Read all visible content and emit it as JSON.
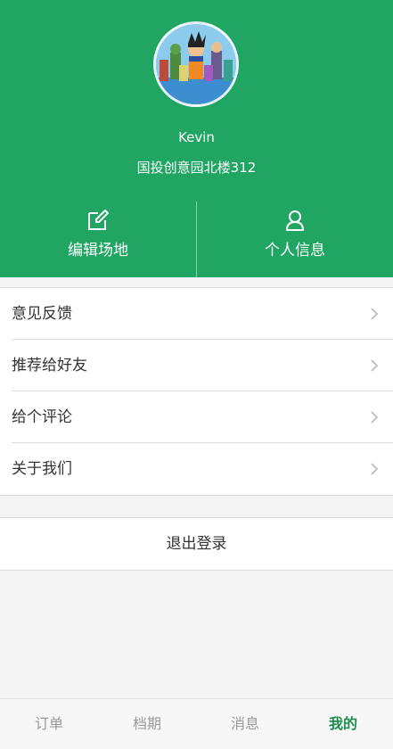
{
  "profile": {
    "name": "Kevin",
    "address": "国投创意园北楼312"
  },
  "header_buttons": [
    {
      "label": "编辑场地",
      "icon": "edit-icon"
    },
    {
      "label": "个人信息",
      "icon": "person-icon"
    }
  ],
  "menu": {
    "items": [
      {
        "label": "意见反馈"
      },
      {
        "label": "推荐给好友"
      },
      {
        "label": "给个评论"
      },
      {
        "label": "关于我们"
      }
    ]
  },
  "logout_label": "退出登录",
  "tabs": [
    {
      "label": "订单",
      "active": false
    },
    {
      "label": "档期",
      "active": false
    },
    {
      "label": "消息",
      "active": false
    },
    {
      "label": "我的",
      "active": true
    }
  ],
  "colors": {
    "header_green": "#20a662",
    "active_tab": "#1c8f4f",
    "inactive_tab": "#9a9a9a"
  }
}
